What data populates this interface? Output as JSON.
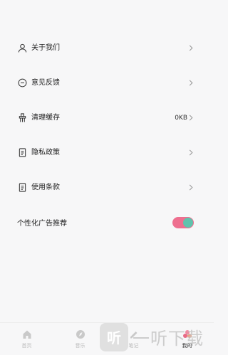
{
  "menu": {
    "items": [
      {
        "icon": "user-icon",
        "label": "关于我们"
      },
      {
        "icon": "feedback-icon",
        "label": "意见反馈"
      },
      {
        "icon": "broom-icon",
        "label": "清理缓存",
        "value": "0KB"
      },
      {
        "icon": "document-icon",
        "label": "隐私政策"
      },
      {
        "icon": "document-icon",
        "label": "使用条款"
      }
    ],
    "toggle": {
      "label": "个性化广告推荐",
      "on": true
    }
  },
  "tabbar": {
    "tabs": [
      {
        "icon": "home-icon",
        "label": "首页"
      },
      {
        "icon": "music-icon",
        "label": "音乐"
      },
      {
        "icon": "note-icon",
        "label": "笔记"
      },
      {
        "icon": "profile-icon",
        "label": "我的",
        "active": true
      }
    ]
  },
  "watermark": {
    "text": "一听下载"
  },
  "colors": {
    "toggle_track": "#ee6f8f",
    "toggle_knob": "#5fc3ad"
  }
}
